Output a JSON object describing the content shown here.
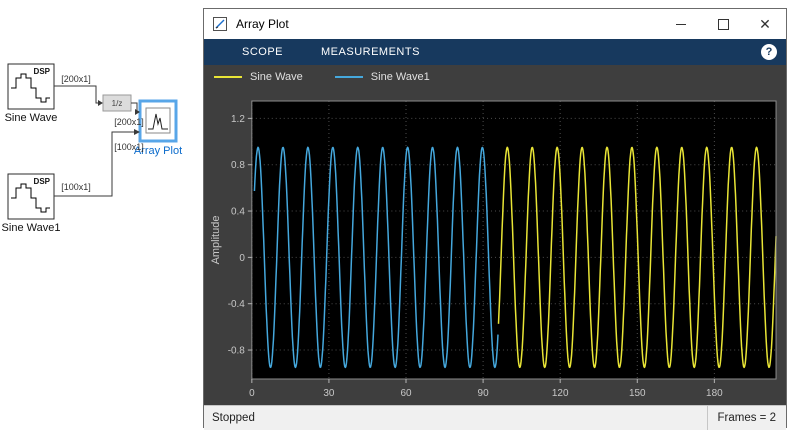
{
  "diagram": {
    "blocks": {
      "sine_wave": {
        "tag": "DSP",
        "label": "Sine Wave"
      },
      "sine_wave1": {
        "tag": "DSP",
        "label": "Sine Wave1"
      },
      "delay": {
        "label": "1/z"
      },
      "array_plot": {
        "label": "Array Plot"
      }
    },
    "signal_labels": {
      "sine_out": "[200x1]",
      "sine_delayed": "[200x1]",
      "sine1_out": "[100x1]",
      "sine1_in": "[100x1]"
    }
  },
  "window": {
    "title": "Array Plot",
    "tabs": [
      "SCOPE",
      "MEASUREMENTS"
    ],
    "help": "?",
    "controls": {
      "close": "✕"
    }
  },
  "legend": [
    {
      "name": "Sine Wave",
      "color": "#e9e536"
    },
    {
      "name": "Sine Wave1",
      "color": "#45a8dd"
    }
  ],
  "status": {
    "left": "Stopped",
    "right": "Frames = 2"
  },
  "chart_data": {
    "type": "line",
    "title": "",
    "xlabel": "",
    "ylabel": "Amplitude",
    "xlim": [
      0,
      204
    ],
    "ylim": [
      -1.05,
      1.35
    ],
    "xticks": [
      0,
      30,
      60,
      90,
      120,
      150,
      180
    ],
    "yticks": [
      -0.8,
      -0.4,
      0,
      0.4,
      0.8,
      1.2
    ],
    "grid": true,
    "background": "#000000",
    "series": [
      {
        "name": "Sine Wave1",
        "color": "#45a8dd",
        "amplitude": 0.95,
        "period": 9.7,
        "x_start": 1,
        "x_end": 96
      },
      {
        "name": "Sine Wave",
        "color": "#e9e536",
        "amplitude": 0.95,
        "period": 9.7,
        "x_start": 96,
        "x_end": 204
      }
    ]
  }
}
